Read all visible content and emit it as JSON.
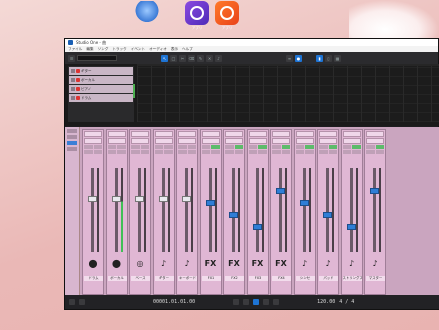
{
  "desktop": {
    "icons": [
      {
        "label": "",
        "color": "#3b7ad6"
      },
      {
        "label": "アプリ",
        "color": "#6a3ad0"
      },
      {
        "label": "アプリ",
        "color": "#f05a24"
      }
    ]
  },
  "window": {
    "title": "Studio One - 曲",
    "menu": [
      "ファイル",
      "編集",
      "ソング",
      "トラック",
      "イベント",
      "オーディオ",
      "表示",
      "ヘルプ"
    ],
    "tracks": [
      "ギター",
      "ボーカル",
      "ピアノ",
      "ドラム"
    ],
    "channels": [
      {
        "icon": "⬤",
        "name": "ドラム",
        "knob": "white",
        "meter": false
      },
      {
        "icon": "⬤",
        "name": "ボーカル",
        "knob": "white",
        "meter": true
      },
      {
        "icon": "◎",
        "name": "ベース",
        "knob": "white",
        "meter": false
      },
      {
        "icon": "♪",
        "name": "ギター",
        "knob": "white",
        "meter": false
      },
      {
        "icon": "♪",
        "name": "キーボード",
        "knob": "white",
        "meter": false
      },
      {
        "icon": "FX",
        "name": "FX1",
        "knob": "blue",
        "meter": false
      },
      {
        "icon": "FX",
        "name": "FX2",
        "knob": "blue",
        "meter": false
      },
      {
        "icon": "FX",
        "name": "FX3",
        "knob": "blue",
        "meter": false
      },
      {
        "icon": "FX",
        "name": "FX4",
        "knob": "blue",
        "meter": false
      },
      {
        "icon": "♪",
        "name": "シンセ",
        "knob": "blue",
        "meter": false
      },
      {
        "icon": "♪",
        "name": "パッド",
        "knob": "blue",
        "meter": false
      },
      {
        "icon": "♪",
        "name": "ストリングス",
        "knob": "blue",
        "meter": false
      },
      {
        "icon": "♪",
        "name": "マスター",
        "knob": "blue",
        "meter": false
      }
    ],
    "status": {
      "time_display": "00001.01.01.00",
      "tempo": "120.00",
      "signature": "4 / 4"
    }
  }
}
